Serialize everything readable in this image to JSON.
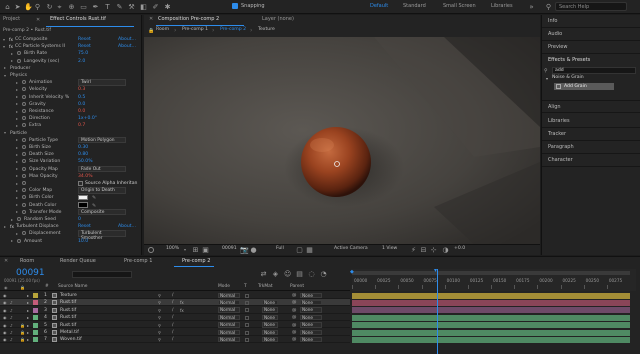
{
  "toolbar": {
    "snapping_label": "Snapping",
    "workspaces": [
      "Default",
      "Standard",
      "Small Screen",
      "Libraries"
    ],
    "active_workspace": "Default",
    "search_placeholder": "Search Help"
  },
  "left_panel": {
    "tabs": [
      "Project",
      "Effect Controls Rust.tif"
    ],
    "breadcrumb": "Pre-comp 2 • Rust.tif",
    "reset_label": "Reset",
    "about_label": "About...",
    "effects": [
      {
        "name": "CC Composite",
        "indent": 0
      },
      {
        "name": "CC Particle Systems II",
        "indent": 0
      }
    ],
    "properties": [
      {
        "label": "Birth Rate",
        "value": "75.0",
        "indent": 1,
        "type": "num"
      },
      {
        "label": "Longevity (sec)",
        "value": "2.0",
        "indent": 1,
        "type": "num"
      },
      {
        "label": "Producer",
        "value": "",
        "indent": 0,
        "type": "group"
      },
      {
        "label": "Physics",
        "value": "",
        "indent": 0,
        "type": "group"
      },
      {
        "label": "Animation",
        "value": "Twirl",
        "indent": 2,
        "type": "dropdown"
      },
      {
        "label": "Velocity",
        "value": "0.3",
        "indent": 2,
        "type": "numred"
      },
      {
        "label": "Inherit Velocity %",
        "value": "0.5",
        "indent": 2,
        "type": "num"
      },
      {
        "label": "Gravity",
        "value": "0.0",
        "indent": 2,
        "type": "num"
      },
      {
        "label": "Resistance",
        "value": "0.0",
        "indent": 2,
        "type": "numred"
      },
      {
        "label": "Direction",
        "value": "1x+0.0°",
        "indent": 2,
        "type": "num"
      },
      {
        "label": "Extra",
        "value": "0.7",
        "indent": 2,
        "type": "numred"
      },
      {
        "label": "Particle",
        "value": "",
        "indent": 0,
        "type": "group"
      },
      {
        "label": "Particle Type",
        "value": "Motion Polygon",
        "indent": 2,
        "type": "dropdown"
      },
      {
        "label": "Birth Size",
        "value": "0.30",
        "indent": 2,
        "type": "num"
      },
      {
        "label": "Death Size",
        "value": "0.80",
        "indent": 2,
        "type": "num"
      },
      {
        "label": "Size Variation",
        "value": "50.0%",
        "indent": 2,
        "type": "num"
      },
      {
        "label": "Opacity Map",
        "value": "Fade Out",
        "indent": 2,
        "type": "dropdown"
      },
      {
        "label": "Max Opacity",
        "value": "34.0%",
        "indent": 2,
        "type": "numred"
      },
      {
        "label": "",
        "value": "Source Alpha Inheritan",
        "indent": 2,
        "type": "checkbox"
      },
      {
        "label": "Color Map",
        "value": "Origin to Death",
        "indent": 2,
        "type": "dropdown"
      },
      {
        "label": "Birth Color",
        "value": "",
        "indent": 2,
        "type": "colorwhite"
      },
      {
        "label": "Death Color",
        "value": "",
        "indent": 2,
        "type": "colorblack"
      },
      {
        "label": "Transfer Mode",
        "value": "Composite",
        "indent": 2,
        "type": "dropdown"
      },
      {
        "label": "Random Seed",
        "value": "0",
        "indent": 1,
        "type": "num"
      },
      {
        "label": "Turbulent Displace",
        "value": "",
        "indent": 0,
        "type": "effect"
      },
      {
        "label": "Displacement",
        "value": "Turbulent Smoother",
        "indent": 2,
        "type": "dropdown"
      },
      {
        "label": "Amount",
        "value": "10.0",
        "indent": 1,
        "type": "num"
      }
    ]
  },
  "comp_panel": {
    "tab_label": "Composition Pre-comp 2",
    "layer_tab": "Layer (none)",
    "crumbs": [
      "Room",
      "Pre-comp 1",
      "Pre-comp 2",
      "Texture"
    ],
    "zoom": "100%",
    "timecode": "00091",
    "resolution": "Full",
    "camera": "Active Camera",
    "views": "1 View",
    "exposure": "+0.0"
  },
  "right_panel": {
    "sections": [
      "Info",
      "Audio",
      "Preview",
      "Effects & Presets"
    ],
    "search_value": "add",
    "tree_group": "Noise & Grain",
    "tree_item": "Add Grain",
    "lower_sections": [
      "Align",
      "Libraries",
      "Tracker",
      "Paragraph",
      "Character"
    ]
  },
  "timeline": {
    "tabs": [
      "Room",
      "Render Queue",
      "Pre-comp 1",
      "Pre-comp 2"
    ],
    "active_tab": "Pre-comp 2",
    "current_time": "00091",
    "time_sub": "00091 (25.00 fps)",
    "search_placeholder": "",
    "headers": {
      "num": "#",
      "source": "Source Name",
      "mode": "Mode",
      "trkmat": "TrkMat",
      "parent": "Parent",
      "t": "T"
    },
    "ruler": [
      "00000",
      "00025",
      "00050",
      "00075",
      "00100",
      "00125",
      "00150",
      "00175",
      "00200",
      "00225",
      "00250",
      "00275"
    ],
    "layers": [
      {
        "num": "1",
        "name": "Texture",
        "mode": "Normal",
        "trkmat": "",
        "parent": "None",
        "bar_color": "#a38d36",
        "label": "#b8a53a"
      },
      {
        "num": "2",
        "name": "Rust.tif",
        "mode": "Normal",
        "trkmat": "None",
        "parent": "None",
        "bar_color": "#8a4558",
        "label": "#c45c7a",
        "selected": true
      },
      {
        "num": "3",
        "name": "Rust.tif",
        "mode": "Normal",
        "trkmat": "None",
        "parent": "None",
        "bar_color": "#6e4a68",
        "label": "#a86aa0"
      },
      {
        "num": "4",
        "name": "Rust.tif",
        "mode": "Normal",
        "trkmat": "None",
        "parent": "None",
        "bar_color": "#4f8a63",
        "label": "#62b07c"
      },
      {
        "num": "5",
        "name": "Rust.tif",
        "mode": "Normal",
        "trkmat": "None",
        "parent": "None",
        "bar_color": "#4f8a63",
        "label": "#62b07c"
      },
      {
        "num": "6",
        "name": "Metal.tif",
        "mode": "Normal",
        "trkmat": "None",
        "parent": "None",
        "bar_color": "#4f8a63",
        "label": "#62b07c"
      },
      {
        "num": "7",
        "name": "Woven.tif",
        "mode": "Normal",
        "trkmat": "None",
        "parent": "None",
        "bar_color": "#4f8a63",
        "label": "#62b07c"
      }
    ]
  },
  "colors": {
    "accent": "#2d8ceb",
    "playhead": "#2d8ceb",
    "keyframe_red": "#e0554a"
  }
}
